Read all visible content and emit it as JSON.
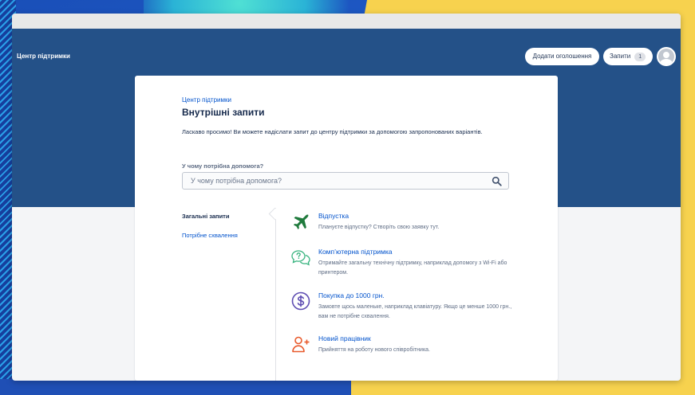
{
  "header": {
    "site_title": "Центр підтримки",
    "add_announcement_label": "Додати оголошення",
    "requests_label": "Запити",
    "requests_count": "1"
  },
  "portal": {
    "breadcrumb": "Центр підтримки",
    "title": "Внутрішні запити",
    "intro": "Ласкаво просимо! Ви можете надіслати запит до центру підтримки за допомогою запропонованих варіантів.",
    "search_label": "У чому потрібна допомога?",
    "search_placeholder": "У чому потрібна допомога?"
  },
  "groups": [
    {
      "label": "Загальні запити",
      "active": true
    },
    {
      "label": "Потрібне схвалення",
      "active": false
    }
  ],
  "request_types": [
    {
      "title": "Відпустка",
      "desc": "Плануєте відпустку? Створіть свою заявку тут.",
      "icon": "airplane-icon",
      "color": "#1f7a3c"
    },
    {
      "title": "Комп’ютерна підтримка",
      "desc": "Отримайте загальну технічну підтримку, наприклад допомогу з Wi-Fi або принтером.",
      "icon": "help-chat-icon",
      "color": "#36b37e"
    },
    {
      "title": "Покупка до 1000 грн.",
      "desc": "Замовте щось маленьке, наприклад клавіатуру. Якщо це менше 1000 грн., вам не потрібне схвалення.",
      "icon": "dollar-icon",
      "color": "#5e4db2"
    },
    {
      "title": "Новий працівник",
      "desc": "Прийняття на роботу нового співробітника.",
      "icon": "add-user-icon",
      "color": "#e8592b"
    }
  ],
  "colors": {
    "header_bg": "#245188",
    "link": "#0052cc",
    "text": "#172b4d"
  }
}
